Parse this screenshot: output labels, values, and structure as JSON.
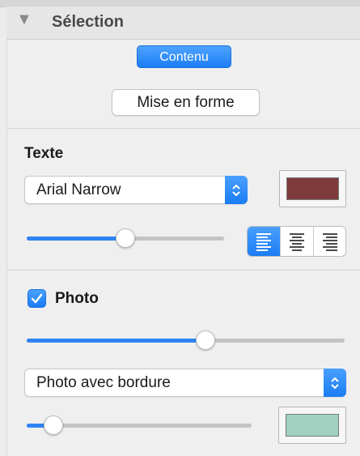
{
  "section": {
    "title": "Sélection",
    "disclosure_icon": "triangle-down-icon"
  },
  "tab": {
    "label": "Contenu"
  },
  "format_button": {
    "label": "Mise en forme"
  },
  "text_group": {
    "label": "Texte",
    "font_popup": {
      "value": "Arial Narrow"
    },
    "text_color": "#7f3b3b",
    "size_slider": {
      "value": 0.5
    },
    "alignment": {
      "options": [
        "align-left-icon",
        "align-center-icon",
        "align-right-icon"
      ],
      "selected": "align-left-icon"
    }
  },
  "photo_group": {
    "label": "Photo",
    "checked": true,
    "slider": {
      "value": 0.57
    },
    "style_popup": {
      "value": "Photo avec bordure"
    },
    "border_slider": {
      "value": 0.12
    },
    "border_color": "#9fd0c0"
  },
  "colors": {
    "accent": "#1b7ef5"
  }
}
